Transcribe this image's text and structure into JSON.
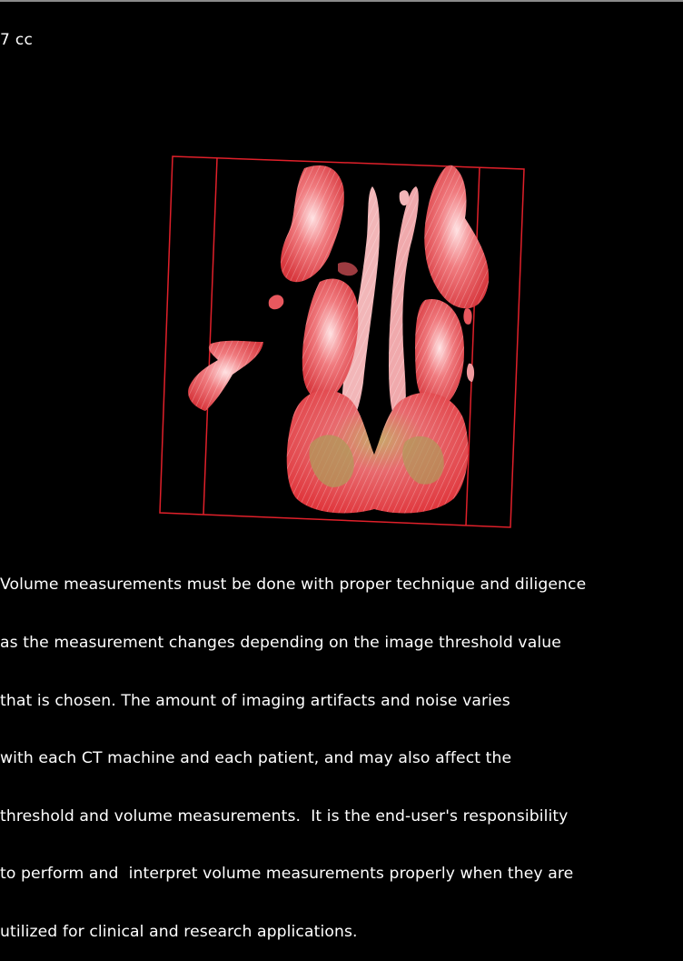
{
  "volume_readout": "7 cc",
  "render": {
    "bounding_box_color": "#e0202a",
    "tissue_color": "#e8585e",
    "highlight_color": "#ffd2d4",
    "core_color": "#b09a5a"
  },
  "disclaimer_lines": [
    "Volume measurements must be done with proper technique and diligence",
    "as the measurement changes depending on the image threshold value",
    "that is chosen. The amount of imaging artifacts and noise varies",
    "with each CT machine and each patient, and may also affect the",
    "threshold and volume measurements.  It is the end-user's responsibility",
    "to perform and  interpret volume measurements properly when they are",
    "utilized for clinical and research applications."
  ]
}
